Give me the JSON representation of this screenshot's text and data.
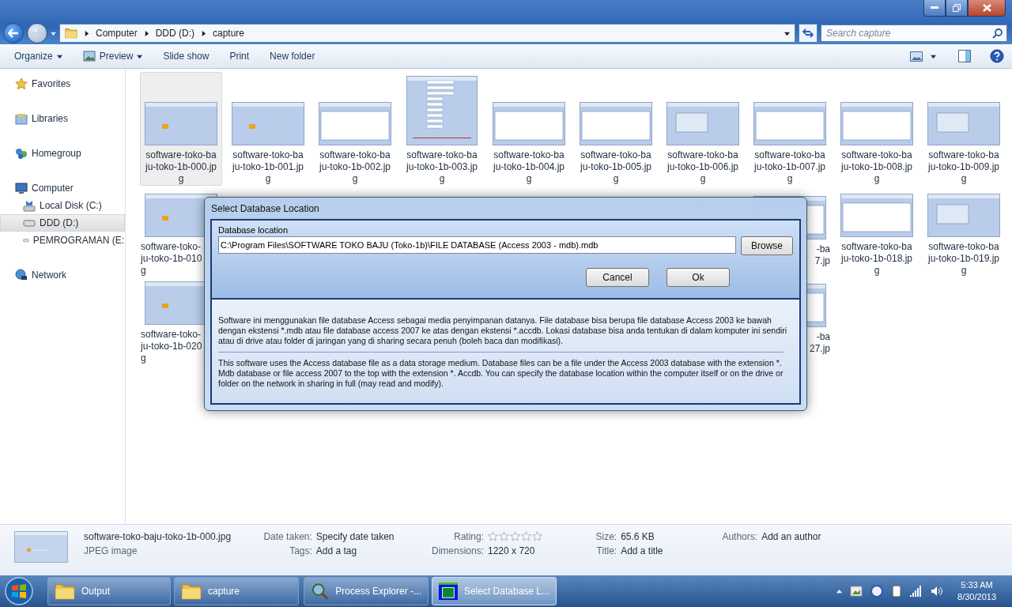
{
  "address": {
    "crumbs": [
      "Computer",
      "DDD (D:)",
      "capture"
    ],
    "search_placeholder": "Search capture"
  },
  "toolbar": {
    "items": [
      {
        "label": "Organize",
        "kind": "menu",
        "dropdown": true
      },
      {
        "label": "Preview",
        "kind": "preview",
        "dropdown": true
      },
      {
        "label": "Slide show",
        "kind": "plain",
        "dropdown": false
      },
      {
        "label": "Print",
        "kind": "plain",
        "dropdown": false
      },
      {
        "label": "New folder",
        "kind": "plain",
        "dropdown": false
      }
    ]
  },
  "sidebar": {
    "items": [
      {
        "label": "Favorites",
        "kind": "star",
        "selected": false
      },
      {
        "label": "Libraries",
        "kind": "library",
        "selected": false
      },
      {
        "label": "Homegroup",
        "kind": "homegroup",
        "selected": false
      },
      {
        "label": "Computer",
        "kind": "computer",
        "selected": false,
        "children": [
          {
            "label": "Local Disk (C:)",
            "kind": "system-disk",
            "selected": false
          },
          {
            "label": "DDD (D:)",
            "kind": "disk",
            "selected": true
          },
          {
            "label": "PEMROGRAMAN (E:",
            "kind": "disk",
            "selected": false
          }
        ]
      },
      {
        "label": "Network",
        "kind": "network",
        "selected": false
      }
    ]
  },
  "files": {
    "rows": [
      [
        {
          "lines": [
            "software-toko-ba",
            "ju-toko-1b-000.jp",
            "g"
          ],
          "selected": true,
          "kind": "whole"
        },
        {
          "lines": [
            "software-toko-ba",
            "ju-toko-1b-001.jp",
            "g"
          ],
          "selected": false,
          "kind": "whole"
        },
        {
          "lines": [
            "software-toko-ba",
            "ju-toko-1b-002.jp",
            "g"
          ],
          "selected": false,
          "kind": "whole"
        },
        {
          "lines": [
            "software-toko-ba",
            "ju-toko-1b-003.jp",
            "g"
          ],
          "selected": false,
          "kind": "whole"
        },
        {
          "lines": [
            "software-toko-ba",
            "ju-toko-1b-004.jp",
            "g"
          ],
          "selected": false,
          "kind": "whole"
        },
        {
          "lines": [
            "software-toko-ba",
            "ju-toko-1b-005.jp",
            "g"
          ],
          "selected": false,
          "kind": "whole"
        },
        {
          "lines": [
            "software-toko-ba",
            "ju-toko-1b-006.jp",
            "g"
          ],
          "selected": false,
          "kind": "whole"
        },
        {
          "lines": [
            "software-toko-ba",
            "ju-toko-1b-007.jp",
            "g"
          ],
          "selected": false,
          "kind": "whole"
        },
        {
          "lines": [
            "software-toko-ba",
            "ju-toko-1b-008.jp",
            "g"
          ],
          "selected": false,
          "kind": "whole"
        },
        {
          "lines": [
            "software-toko-ba",
            "ju-toko-1b-009.jp",
            "g"
          ],
          "selected": false,
          "kind": "whole"
        }
      ],
      [
        {
          "lines": [
            "software-toko-",
            "ju-toko-1b-010",
            "g"
          ],
          "selected": false,
          "kind": "cut-right"
        },
        null,
        null,
        null,
        null,
        null,
        null,
        {
          "lines": [
            "-ba",
            "7.jp"
          ],
          "selected": false,
          "kind": "cut-left"
        },
        {
          "lines": [
            "software-toko-ba",
            "ju-toko-1b-018.jp",
            "g"
          ],
          "selected": false,
          "kind": "whole"
        },
        {
          "lines": [
            "software-toko-ba",
            "ju-toko-1b-019.jp",
            "g"
          ],
          "selected": false,
          "kind": "whole"
        }
      ],
      [
        {
          "lines": [
            "software-toko-",
            "ju-toko-1b-020",
            "g"
          ],
          "selected": false,
          "kind": "cut-right"
        },
        null,
        null,
        null,
        null,
        null,
        null,
        {
          "lines": [
            "-ba",
            "27.jp"
          ],
          "selected": false,
          "kind": "cut-left"
        },
        null,
        null
      ]
    ]
  },
  "details": {
    "name": "software-toko-baju-toko-1b-000.jpg",
    "type": "JPEG image",
    "columns": [
      [
        {
          "label": "Date taken:",
          "value": "Specify date taken",
          "kind": "text"
        },
        {
          "label": "Tags:",
          "value": "Add a tag",
          "kind": "text"
        }
      ],
      [
        {
          "label": "Rating:",
          "kind": "rating",
          "stars": 0
        },
        {
          "label": "Dimensions:",
          "value": "1220 x 720",
          "kind": "text"
        }
      ],
      [
        {
          "label": "Size:",
          "value": "65.6 KB",
          "kind": "text"
        },
        {
          "label": "Title:",
          "value": "Add a title",
          "kind": "text"
        }
      ],
      [
        {
          "label": "Authors:",
          "value": "Add an author",
          "kind": "text"
        }
      ]
    ]
  },
  "dialog": {
    "title": "Select Database Location",
    "field_label": "Database location",
    "field_value": "C:\\Program Files\\SOFTWARE TOKO BAJU (Toko-1b)\\FILE DATABASE (Access 2003 - mdb).mdb",
    "browse": "Browse",
    "cancel": "Cancel",
    "ok": "Ok",
    "paragraphs": [
      "Software ini menggunakan file database Access sebagai media penyimpanan datanya. File database bisa berupa file database Access 2003 ke bawah dengan ekstensi *.mdb atau file database access 2007 ke atas dengan ekstensi *.accdb. Lokasi database bisa anda tentukan di dalam komputer ini sendiri atau di drive atau folder di jaringan yang di sharing secara penuh (boleh baca dan modifikasi).",
      "This software uses the Access database file as a data storage medium. Database files can be a file under the Access 2003 database with the extension *. Mdb database or file access 2007 to the top with the extension *. Accdb. You can specify the database location within the computer itself or on the drive or folder on the network in sharing in full (may read and modify)."
    ]
  },
  "taskbar": {
    "tasks": [
      {
        "label": "Output",
        "kind": "folder",
        "active": false
      },
      {
        "label": "capture",
        "kind": "folder",
        "active": false
      },
      {
        "label": "Process Explorer -...",
        "kind": "process",
        "active": false
      },
      {
        "label": "Select Database L...",
        "kind": "app",
        "active": true
      }
    ],
    "time": "5:33 AM",
    "date": "8/30/2013"
  }
}
